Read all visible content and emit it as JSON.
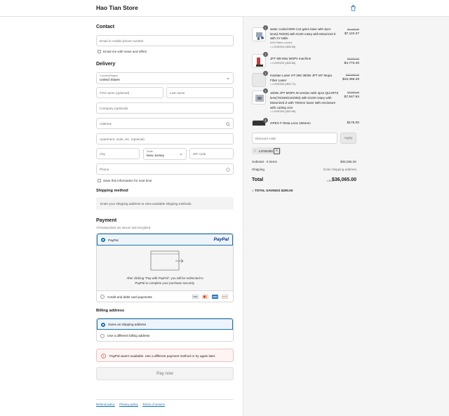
{
  "header": {
    "store_name": "Hao Tian Store"
  },
  "contact": {
    "heading": "Contact",
    "email_placeholder": "Email or mobile phone number",
    "news_label": "Email me with news and offers"
  },
  "delivery": {
    "heading": "Delivery",
    "country_label": "Country/Region",
    "country_value": "United States",
    "first_name_placeholder": "First name (optional)",
    "last_name_placeholder": "Last name",
    "company_placeholder": "Company (optional)",
    "address_placeholder": "Address",
    "apartment_placeholder": "Apartment, suite, etc. (optional)",
    "city_placeholder": "City",
    "state_label": "State",
    "state_value": "New Jersey",
    "zip_placeholder": "ZIP code",
    "phone_placeholder": "Phone",
    "save_label": "Save this information for next time"
  },
  "shipping_method": {
    "heading": "Shipping method",
    "notice": "Enter your shipping address to view available shipping methods."
  },
  "payment": {
    "heading": "Payment",
    "subtitle": "All transactions are secure and encrypted.",
    "paypal_label": "PayPal",
    "paypal_logo": "PayPal",
    "redirect_text": "After clicking “Pay with PayPal”, you will be redirected to PayPal to complete your purchase securely.",
    "card_label": "Credit and debit card payments",
    "card_brands": [
      "VISA",
      "MC",
      "AMEX",
      "DISC"
    ]
  },
  "billing": {
    "heading": "Billing address",
    "same_label": "Same as shipping address",
    "different_label": "Use a different billing address"
  },
  "error": {
    "message": "PayPal wasn't available. Use a different payment method or try again later."
  },
  "pay_button": "Pay now",
  "footer_links": [
    "Refund policy",
    "Privacy policy",
    "Terms of service"
  ],
  "order": {
    "items": [
      {
        "qty": "1",
        "name": "water cooled 60W Co2 galvo laser with 2pcs lens(175/300) with D100 rotary with Motorized Z with XY table",
        "variant": "60W Water-cooled",
        "discount": "LOVE200 (-$39.63)",
        "old_price": "$7,150.00",
        "price": "$7,110.37"
      },
      {
        "qty": "1",
        "name": "JPT M8 50w MOPA machine",
        "discount": "LOVE200 (-$26.60)",
        "old_price": "$4,800.00",
        "price": "$4,773.40"
      },
      {
        "qty": "1",
        "name": "Haotian Laser HT-350 350W JPT M7 Mopa Fiber Laser",
        "discount": "LOVE200 (-$91.71)",
        "old_price": "$16,550.00",
        "price": "$16,458.29"
      },
      {
        "qty": "1",
        "name": "100W JPT MOPA M version with 4pcs QUARTZ lens(70/150/210/300) with D100 rotary with Motorized Z with 700mm lower with enclosure with cutting vice",
        "discount": "LOVE200 (-$42.06)",
        "old_price": "$7,590.00",
        "price": "$7,547.94"
      },
      {
        "qty": "1",
        "name": "OPEX F-theta Lens 1064nm",
        "price": "$175.00"
      }
    ],
    "discount_placeholder": "Discount code",
    "apply_label": "Apply",
    "applied_code": "LOVE200",
    "subtotal_label": "Subtotal · 5 items",
    "subtotal_value": "$36,065.00",
    "shipping_label": "Shipping",
    "shipping_value": "Enter shipping address",
    "total_label": "Total",
    "currency": "USD",
    "total_value": "$36,065.00",
    "savings_label": "TOTAL SAVINGS",
    "savings_value": "$200.00"
  },
  "colors": {
    "accent": "#1773b0",
    "error_bg": "#fff4f4",
    "error_border": "#e32c2b"
  }
}
